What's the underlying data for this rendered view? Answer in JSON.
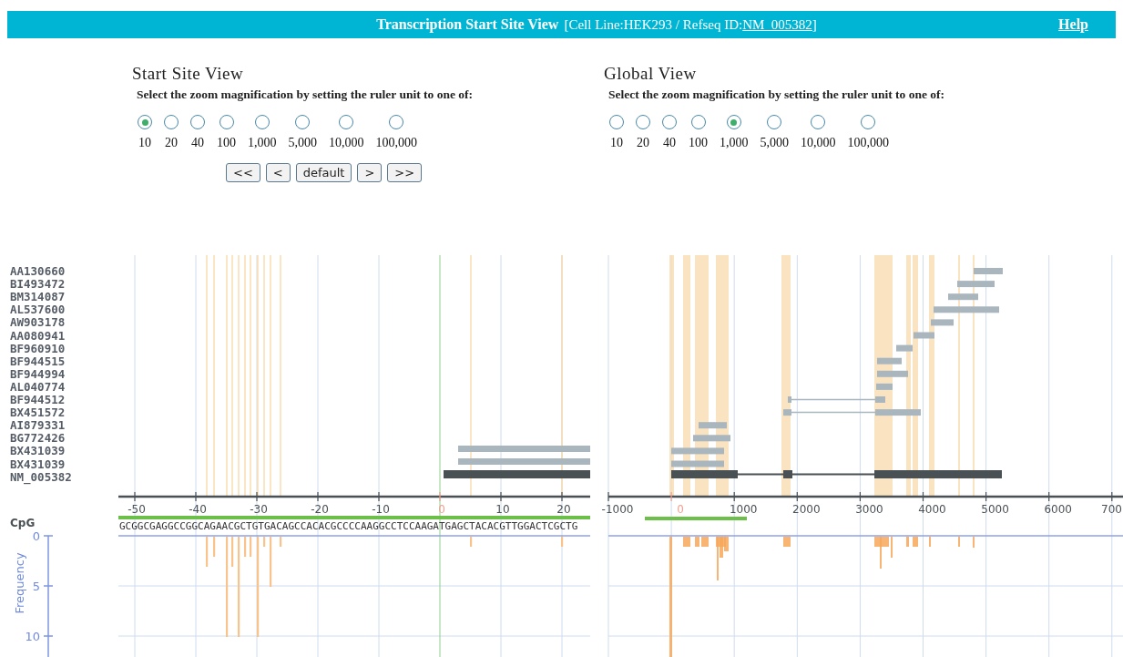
{
  "header": {
    "title": "Transcription Start Site View",
    "context_prefix": "[Cell Line:HEK293 / Refseq ID:",
    "refseq_link": "NM_005382",
    "context_suffix": "]",
    "help_link": "Help"
  },
  "views": [
    {
      "title": "Start Site View",
      "instruction": "Select the zoom magnification by setting the ruler unit to one of:",
      "zoom_options": [
        {
          "label": "10",
          "selected": true
        },
        {
          "label": "20",
          "selected": false
        },
        {
          "label": "40",
          "selected": false
        },
        {
          "label": "100",
          "selected": false
        },
        {
          "label": "1,000",
          "selected": false
        },
        {
          "label": "5,000",
          "selected": false
        },
        {
          "label": "10,000",
          "selected": false
        },
        {
          "label": "100,000",
          "selected": false
        }
      ],
      "buttons": [
        "<<",
        "<",
        "default",
        ">",
        ">>"
      ]
    },
    {
      "title": "Global View",
      "instruction": "Select the zoom magnification by setting the ruler unit to one of:",
      "zoom_options": [
        {
          "label": "10",
          "selected": false
        },
        {
          "label": "20",
          "selected": false
        },
        {
          "label": "40",
          "selected": false
        },
        {
          "label": "100",
          "selected": false
        },
        {
          "label": "1,000",
          "selected": true
        },
        {
          "label": "5,000",
          "selected": false
        },
        {
          "label": "10,000",
          "selected": false
        },
        {
          "label": "100,000",
          "selected": false
        }
      ]
    }
  ],
  "tracks": [
    "AA130660",
    "BI493472",
    "BM314087",
    "AL537600",
    "AW903178",
    "AA080941",
    "BF960910",
    "BF944515",
    "BF944994",
    "AL040774",
    "BF944512",
    "BX451572",
    "AI879331",
    "BG772426",
    "BX431039",
    "BX431039",
    "NM_005382"
  ],
  "start_site_ruler": {
    "ticks": [
      {
        "label": "-50",
        "highlight": false
      },
      {
        "label": "-40",
        "highlight": false
      },
      {
        "label": "-30",
        "highlight": false
      },
      {
        "label": "-20",
        "highlight": false
      },
      {
        "label": "-10",
        "highlight": false
      },
      {
        "label": "0",
        "highlight": true
      },
      {
        "label": "10",
        "highlight": false
      },
      {
        "label": "20",
        "highlight": false
      }
    ]
  },
  "global_ruler": {
    "ticks": [
      {
        "label": "-1000",
        "highlight": false
      },
      {
        "label": "0",
        "highlight": true
      },
      {
        "label": "1000",
        "highlight": false
      },
      {
        "label": "2000",
        "highlight": false
      },
      {
        "label": "3000",
        "highlight": false
      },
      {
        "label": "4000",
        "highlight": false
      },
      {
        "label": "5000",
        "highlight": false
      },
      {
        "label": "6000",
        "highlight": false
      },
      {
        "label": "700",
        "highlight": false
      }
    ]
  },
  "cpg_label": "CpG",
  "sequence": "GCGGCGAGGCCGGCAGAACGCTGTGACAGCCACACGCCCCAAGGCCTCCAAGATGAGCTACACGTTGGACTCGCTG",
  "frequency_axis": {
    "label": "Frequency",
    "ticks": [
      "0",
      "5",
      "10"
    ]
  }
}
